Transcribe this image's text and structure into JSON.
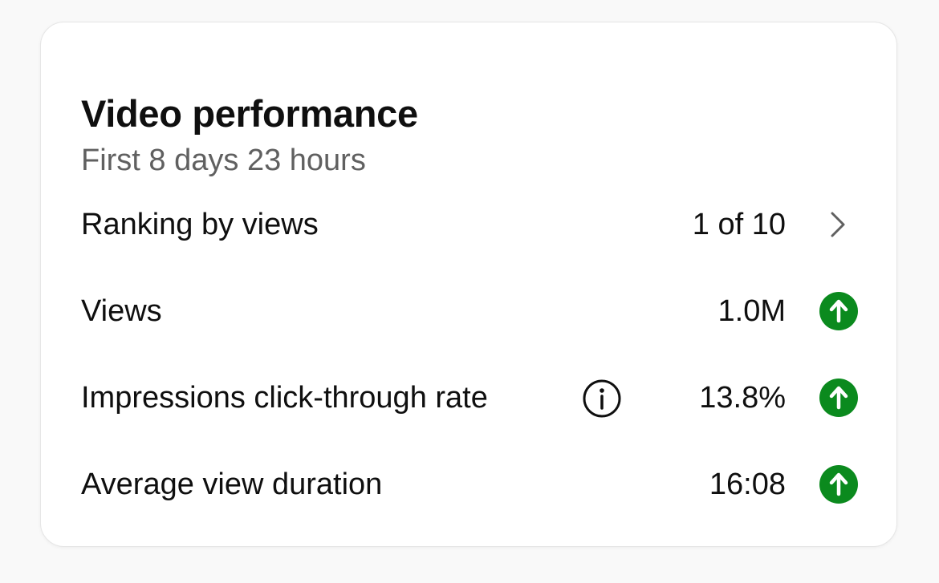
{
  "card": {
    "title": "Video performance",
    "subtitle": "First 8 days 23 hours"
  },
  "metrics": [
    {
      "label": "Ranking by views",
      "value": "1 of 10",
      "action_icon": "chevron-right-icon"
    },
    {
      "label": "Views",
      "value": "1.0M",
      "trend_icon": "arrow-up-circle-icon",
      "trend": "up"
    },
    {
      "label": "Impressions click-through rate",
      "info_icon": "info-icon",
      "value": "13.8%",
      "trend_icon": "arrow-up-circle-icon",
      "trend": "up"
    },
    {
      "label": "Average view duration",
      "value": "16:08",
      "trend_icon": "arrow-up-circle-icon",
      "trend": "up"
    }
  ],
  "colors": {
    "trend_up": "#0b8a1e",
    "secondary_text": "#606060",
    "primary_text": "#0f0f0f"
  }
}
